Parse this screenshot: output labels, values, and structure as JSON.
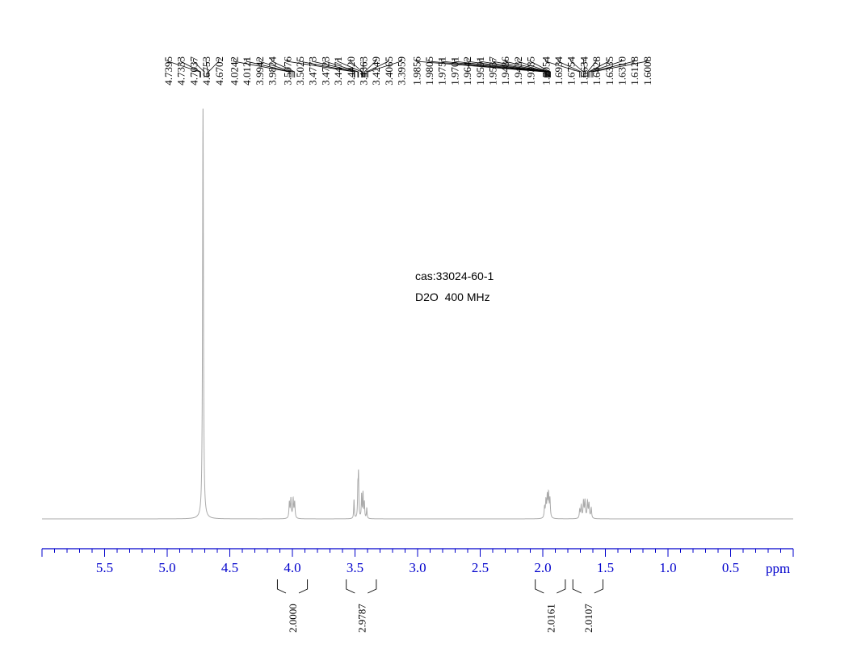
{
  "chart_data": {
    "type": "line",
    "title": "",
    "xlabel": "",
    "ylabel": "",
    "x_unit": "ppm",
    "x_reversed": true,
    "xlim": [
      6.0,
      0.0
    ],
    "x_ticks": [
      5.5,
      5.0,
      4.5,
      4.0,
      3.5,
      3.0,
      2.5,
      2.0,
      1.5,
      1.0,
      0.5
    ],
    "x_tick_labels": [
      "5.5",
      "5.0",
      "4.5",
      "4.0",
      "3.5",
      "3.0",
      "2.5",
      "2.0",
      "1.5",
      "1.0",
      "0.5"
    ],
    "grid": false,
    "annotations": [
      "cas:33024-60-1",
      "D2O  400 MHz"
    ],
    "peak_labels": [
      [
        4.7395,
        4.7333,
        4.7037,
        4.6753,
        4.6702
      ],
      [
        4.0242,
        4.0121,
        3.9942,
        3.9824
      ],
      [
        3.5076,
        3.5025,
        3.4773,
        3.4723,
        3.4471,
        3.442,
        3.4363,
        3.4249,
        3.4065,
        3.3959
      ],
      [
        1.9856,
        1.9805,
        1.9751,
        1.9701,
        1.9642,
        1.9591,
        1.9537,
        1.9486,
        1.9432,
        1.9385
      ],
      [
        1.7054,
        1.6934,
        1.6754,
        1.6634,
        1.6428,
        1.6335,
        1.631,
        1.6128,
        1.6008
      ]
    ],
    "peak_label_text": [
      [
        "4.7395",
        "4.7333",
        "4.7037",
        "4.6753",
        "4.6702"
      ],
      [
        "4.0242",
        "4.0121",
        "3.9942",
        "3.9824"
      ],
      [
        "3.5076",
        "3.5025",
        "3.4773",
        "3.4723",
        "3.4471",
        "3.4420",
        "3.4363",
        "3.4249",
        "3.4065",
        "3.3959"
      ],
      [
        "1.9856",
        "1.9805",
        "1.9751",
        "1.9701",
        "1.9642",
        "1.9591",
        "1.9537",
        "1.9486",
        "1.9432",
        "1.9385"
      ],
      [
        "1.7054",
        "1.6934",
        "1.6754",
        "1.6634",
        "1.6428",
        "1.6335",
        "1.6310",
        "1.6128",
        "1.6008"
      ]
    ],
    "integrals": [
      {
        "from": 4.12,
        "to": 3.88,
        "value": "2.0000"
      },
      {
        "from": 3.57,
        "to": 3.33,
        "value": "2.9787"
      },
      {
        "from": 2.06,
        "to": 1.82,
        "value": "2.0161"
      },
      {
        "from": 1.76,
        "to": 1.52,
        "value": "2.0107"
      }
    ],
    "spectrum_peaks": [
      {
        "ppm": 4.714,
        "height": 1.0,
        "width": 0.004
      },
      {
        "ppm": 4.024,
        "height": 0.038,
        "width": 0.004
      },
      {
        "ppm": 4.012,
        "height": 0.046,
        "width": 0.004
      },
      {
        "ppm": 3.994,
        "height": 0.046,
        "width": 0.004
      },
      {
        "ppm": 3.982,
        "height": 0.038,
        "width": 0.004
      },
      {
        "ppm": 3.508,
        "height": 0.045,
        "width": 0.003
      },
      {
        "ppm": 3.477,
        "height": 0.066,
        "width": 0.003
      },
      {
        "ppm": 3.472,
        "height": 0.1,
        "width": 0.003
      },
      {
        "ppm": 3.447,
        "height": 0.056,
        "width": 0.003
      },
      {
        "ppm": 3.436,
        "height": 0.06,
        "width": 0.003
      },
      {
        "ppm": 3.425,
        "height": 0.038,
        "width": 0.003
      },
      {
        "ppm": 3.406,
        "height": 0.025,
        "width": 0.003
      },
      {
        "ppm": 1.986,
        "height": 0.025,
        "width": 0.004
      },
      {
        "ppm": 1.975,
        "height": 0.04,
        "width": 0.004
      },
      {
        "ppm": 1.964,
        "height": 0.05,
        "width": 0.004
      },
      {
        "ppm": 1.954,
        "height": 0.055,
        "width": 0.004
      },
      {
        "ppm": 1.943,
        "height": 0.045,
        "width": 0.004
      },
      {
        "ppm": 1.705,
        "height": 0.02,
        "width": 0.004
      },
      {
        "ppm": 1.693,
        "height": 0.03,
        "width": 0.004
      },
      {
        "ppm": 1.675,
        "height": 0.04,
        "width": 0.004
      },
      {
        "ppm": 1.663,
        "height": 0.042,
        "width": 0.004
      },
      {
        "ppm": 1.643,
        "height": 0.04,
        "width": 0.004
      },
      {
        "ppm": 1.631,
        "height": 0.035,
        "width": 0.004
      },
      {
        "ppm": 1.613,
        "height": 0.025,
        "width": 0.004
      }
    ],
    "colors": {
      "axis": "#0000cc",
      "spectrum": "#aaaaaa",
      "peak_lines": "#000000"
    }
  }
}
